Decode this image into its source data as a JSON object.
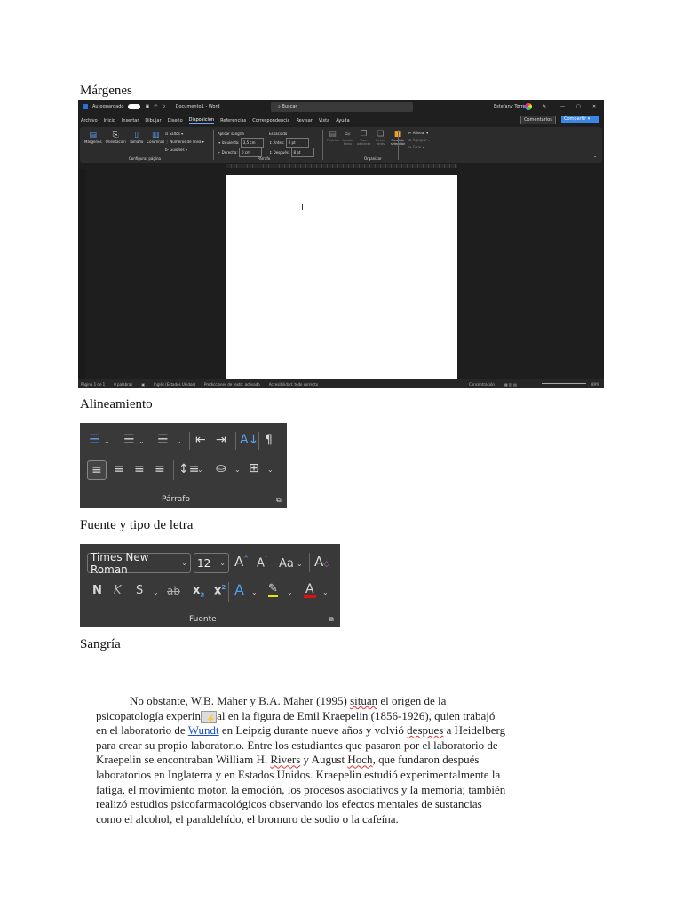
{
  "headings": {
    "margins": "Márgenes",
    "alignment": "Alineamiento",
    "font": "Fuente y tipo de letra",
    "indent": "Sangría"
  },
  "word": {
    "autosave": "Autoguardado",
    "doc_title": "Documento1 - Word",
    "search_placeholder": "Buscar",
    "user": "Estefany Torres",
    "tabs": [
      "Archivo",
      "Inicio",
      "Insertar",
      "Dibujar",
      "Diseño",
      "Disposición",
      "Referencias",
      "Correspondencia",
      "Revisar",
      "Vista",
      "Ayuda"
    ],
    "active_tab": "Disposición",
    "comments": "Comentarios",
    "share": "Compartir",
    "page_setup": {
      "buttons": [
        "Márgenes",
        "Orientación",
        "Tamaño",
        "Columnas"
      ],
      "saltos": "Saltos",
      "numeros": "Números de línea",
      "guiones": "Guiones",
      "group": "Configurar página"
    },
    "indent": {
      "title": "Aplicar sangría",
      "left_label": "Izquierda:",
      "left_value": "3,5 cm",
      "right_label": "Derecha:",
      "right_value": "0 cm"
    },
    "spacing": {
      "title": "Espaciado",
      "before_label": "Antes:",
      "before_value": "0 pt",
      "after_label": "Después:",
      "after_value": "8 pt",
      "group": "Párrafo"
    },
    "arrange": {
      "posicion": "Posición",
      "ajustar": "Ajustar texto",
      "traer": "Traer adelante",
      "enviar": "Enviar atrás",
      "panel": "Panel de selección",
      "alinear": "Alinear",
      "agrupar": "Agrupar",
      "girar": "Girar",
      "group": "Organizar"
    },
    "status": {
      "page": "Página 1 de 1",
      "words": "0 palabras",
      "lang": "Inglés (Estados Unidos)",
      "predictions": "Predicciones de texto: activado",
      "accessibility": "Accesibilidad: todo correcto",
      "focus": "Concentración",
      "zoom": "89%"
    }
  },
  "paragraph_group": {
    "label": "Párrafo"
  },
  "font_group": {
    "font_name": "Times New Roman",
    "font_size": "12",
    "label": "Fuente",
    "bold": "N",
    "italic": "K",
    "underline": "S"
  },
  "body": {
    "p1": "No obstante, W.B. Maher y B.A. Maher (1995) ",
    "w_situan": "situan",
    "p2": " el origen de la psicopatología experin",
    "p3": "al en la figura de Emil Kraepelin (1856-1926), quien trabajó en el laboratorio de ",
    "link": "Wundt",
    "p4": " en Leipzig durante nueve años y volvió ",
    "w_despues": "despues",
    "p5": " a Heidelberg para crear su propio laboratorio. Entre los estudiantes que pasaron por el laboratorio de Kraepelin se encontraban William H. ",
    "w_rivers": "Rivers",
    "p6": " y August ",
    "w_hoch": "Hoch",
    "p7": ", que fundaron después laboratorios en Inglaterra y en Estados Unidos. Kraepelin estudió experimentalmente la fatiga, el movimiento motor, la emoción, los procesos asociativos y la memoria; también realizó estudios psicofarmacológicos observando los efectos mentales de sustancias como el alcohol, el paraldehído, el bromuro de sodio o la cafeína."
  }
}
